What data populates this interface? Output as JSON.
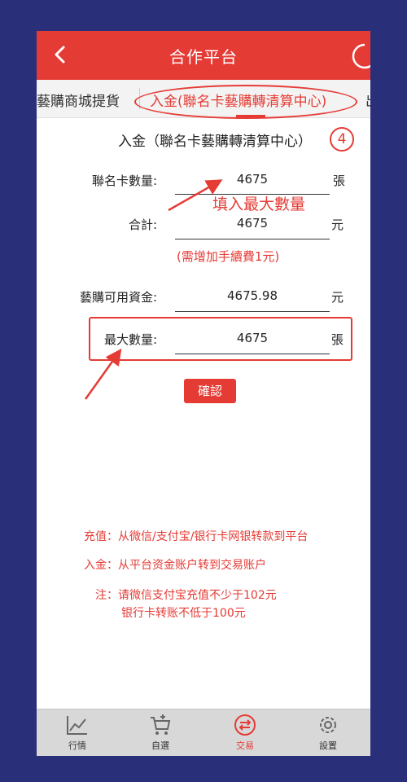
{
  "header": {
    "title": "合作平台"
  },
  "tabs": [
    {
      "label": "藝購商城提貨"
    },
    {
      "label": "入金(聯名卡藝購轉清算中心)"
    },
    {
      "label": "出"
    }
  ],
  "section": {
    "title": "入金（聯名卡藝購轉清算中心）",
    "step": "4"
  },
  "form": {
    "card_count": {
      "label": "聯名卡數量:",
      "value": "4675",
      "unit": "張"
    },
    "total": {
      "label": "合計:",
      "value": "4675",
      "unit": "元"
    },
    "fee_hint": "(需增加手續費1元)",
    "available_funds": {
      "label": "藝購可用資金:",
      "value": "4675.98",
      "unit": "元"
    },
    "max_quantity": {
      "label": "最大數量:",
      "value": "4675",
      "unit": "張"
    },
    "confirm_label": "確認"
  },
  "annotation": {
    "fill_max": "填入最大數量"
  },
  "notes": {
    "recharge": "充值：从微信/支付宝/银行卡网银转款到平台",
    "deposit": "入金：从平台资金账户转到交易账户",
    "note_line1": "注：请微信支付宝充值不少于102元",
    "note_line2": "银行卡转账不低于100元"
  },
  "bottom_nav": [
    {
      "label": "行情",
      "icon": "chart-icon"
    },
    {
      "label": "自選",
      "icon": "cart-add-icon"
    },
    {
      "label": "交易",
      "icon": "exchange-icon",
      "active": true
    },
    {
      "label": "設置",
      "icon": "gear-icon"
    }
  ],
  "colors": {
    "accent": "#e53b35",
    "background": "#2a2f7a"
  }
}
